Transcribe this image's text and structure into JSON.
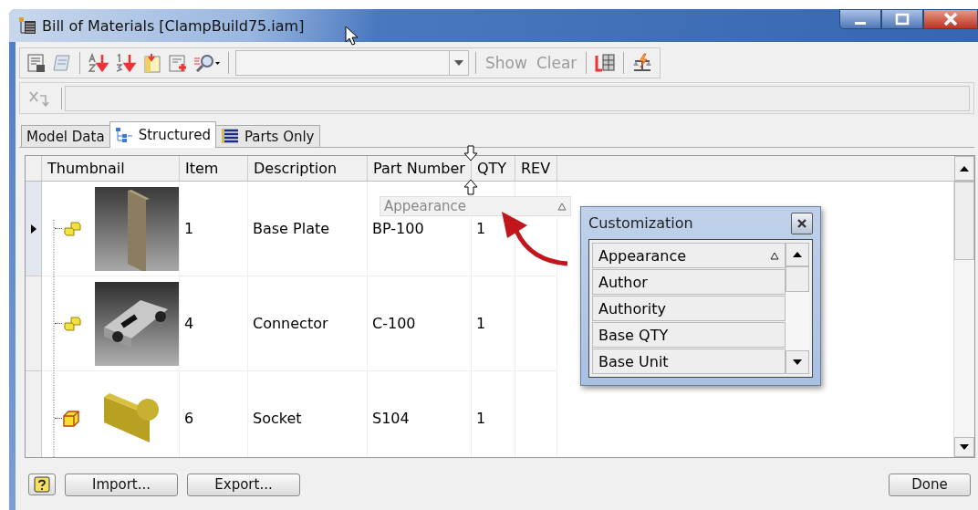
{
  "window": {
    "title": "Bill of Materials [ClampBuild75.iam]"
  },
  "toolbar": {
    "actions": [
      {
        "label": "Show",
        "disabled": true
      },
      {
        "label": "Clear",
        "disabled": true
      }
    ]
  },
  "tabs": [
    {
      "label": "Model Data",
      "selected": false,
      "kind": "plain"
    },
    {
      "label": "Structured",
      "selected": true,
      "kind": "structured"
    },
    {
      "label": "Parts Only",
      "selected": false,
      "kind": "parts"
    }
  ],
  "table": {
    "columns": [
      "Thumbnail",
      "Item",
      "Description",
      "Part Number",
      "QTY",
      "REV"
    ],
    "rows": [
      {
        "selected": true,
        "kind": "assembly",
        "item": "1",
        "description": "Base Plate",
        "part_number": "BP-100",
        "qty": "1"
      },
      {
        "selected": false,
        "kind": "assembly",
        "item": "4",
        "description": "Connector",
        "part_number": "C-100",
        "qty": "1"
      },
      {
        "selected": false,
        "kind": "part",
        "item": "6",
        "description": "Socket",
        "part_number": "S104",
        "qty": "1"
      }
    ]
  },
  "drag_header": {
    "label": "Appearance",
    "sorted": true
  },
  "customization": {
    "title": "Customization",
    "items": [
      {
        "label": "Appearance",
        "sorted": true
      },
      {
        "label": "Author",
        "sorted": false
      },
      {
        "label": "Authority",
        "sorted": false
      },
      {
        "label": "Base QTY",
        "sorted": false
      },
      {
        "label": "Base Unit",
        "sorted": false
      }
    ]
  },
  "footer": {
    "buttons": [
      {
        "label": "Import..."
      },
      {
        "label": "Export..."
      }
    ],
    "done": "Done"
  }
}
